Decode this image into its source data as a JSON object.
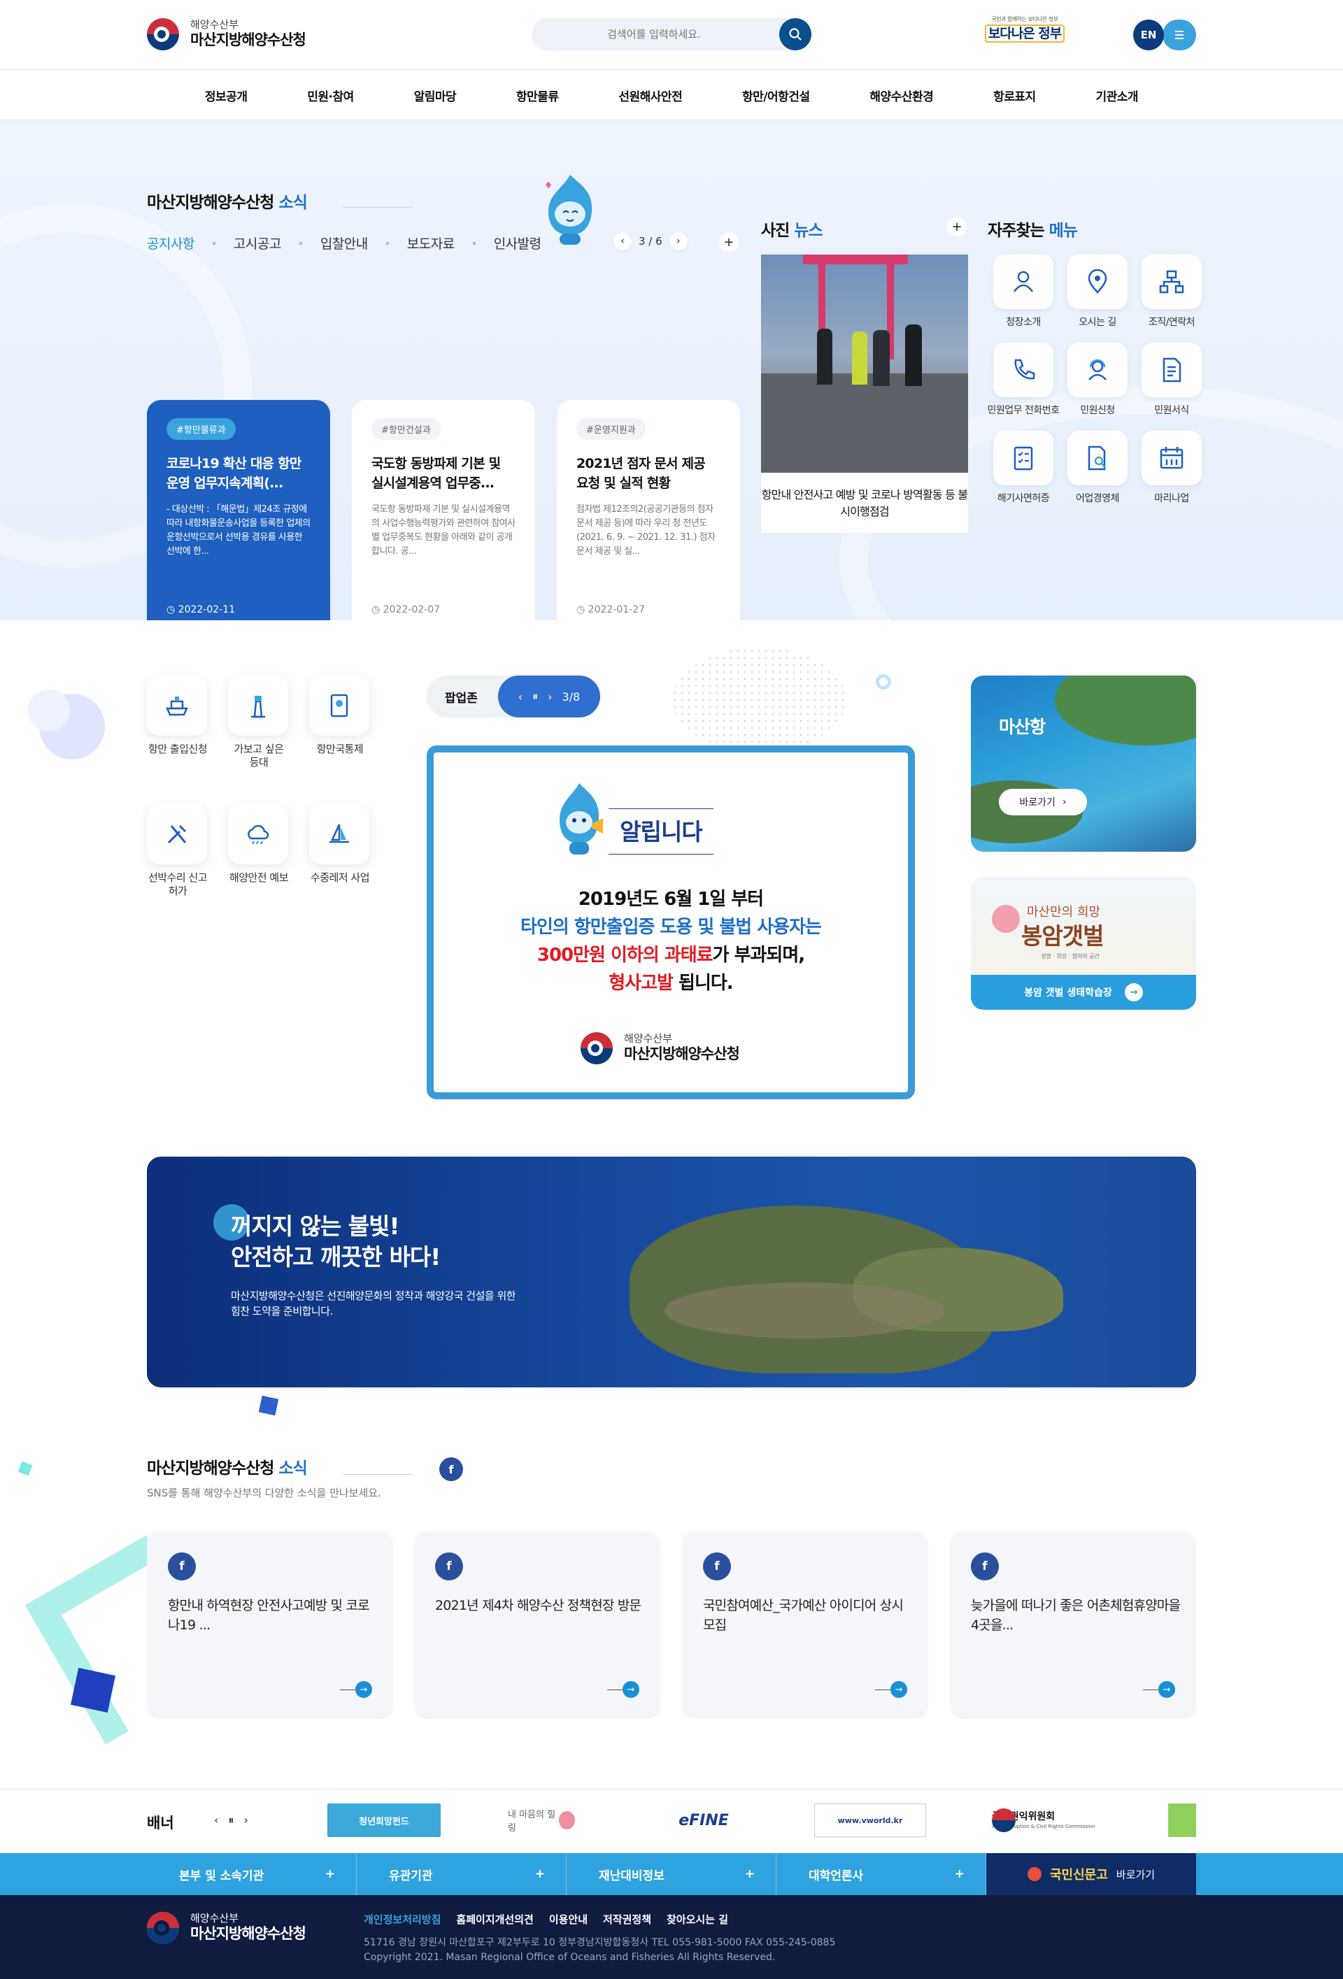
{
  "header": {
    "org_small": "해양수산부",
    "org_name": "마산지방해양수산청",
    "search_placeholder": "검색어를 입력하세요.",
    "gov_small": "국민과 함께하는 보다나은 정부",
    "gov_slogan": "보다나은 정부",
    "lang": "EN"
  },
  "gnb": [
    "정보공개",
    "민원·참여",
    "알림마당",
    "항만물류",
    "선원해사안전",
    "항만/어항건설",
    "해양수산환경",
    "항로표지",
    "기관소개"
  ],
  "news": {
    "title_a": "마산지방해양수산청",
    "title_b": "소식",
    "tabs": [
      "공지사항",
      "고시공고",
      "입찰안내",
      "보도자료",
      "인사발령"
    ],
    "pager": "3 / 6",
    "cards": [
      {
        "tag": "#항만물류과",
        "title": "코로나19 확산 대응 항만 운영 업무지속계획(...",
        "body": "- 대상선박 : 「해운법」제24조 규정에 따라 내항화물운송사업을 등록한 업체의 운항선박으로서 선박용 경유를 사용한 선박에 한...",
        "date": "2022-02-11"
      },
      {
        "tag": "#항만건설과",
        "title": "국도항 동방파제 기본 및 실시설계용역 업무중...",
        "body": "국도항 동방파제 기본 및 실시설계용역의 사업수행능력평가와 관련하여 참여사별 업무중복도 현황을 아래와 같이 공개합니다. 공...",
        "date": "2022-02-07"
      },
      {
        "tag": "#운영지원과",
        "title": "2021년 점자 문서 제공 요청 및 실적 현황",
        "body": "점자법 제12조의2(공공기관등의 점자 문서 제공 등)에 따라 우리 청 전년도(2021. 6. 9. ~ 2021. 12. 31.) 점자 문서 제공 및 실...",
        "date": "2022-01-27"
      }
    ]
  },
  "photo_news": {
    "title_a": "사진",
    "title_b": "뉴스",
    "caption": "항만내 안전사고 예방 및 코로나 방역활동 등 불시이행점검"
  },
  "quick": {
    "title_a": "자주찾는",
    "title_b": "메뉴",
    "items": [
      "청장소개",
      "오시는 길",
      "조직/연락처",
      "민원업무 전화번호",
      "민원신청",
      "민원서식",
      "해기사면허증",
      "어업경영체",
      "마리나업"
    ]
  },
  "services": [
    "항만 출입신청",
    "가보고 싶은 등대",
    "항만국통제",
    "선박수리 신고허가",
    "해양안전 예보",
    "수중레저 사업"
  ],
  "popup": {
    "label": "팝업존",
    "pager": "3/8",
    "head": "알립니다",
    "line1": "2019년도 6월 1일 부터",
    "line2": "타인의 항만출입증 도용 및 불법 사용자는",
    "line3_red": "300만원 이하의 과태료",
    "line3_rest": "가 부과되며,",
    "line4_red": "형사고발",
    "line4_rest": " 됩니다.",
    "org_small": "해양수산부",
    "org_name": "마산지방해양수산청"
  },
  "side_banners": {
    "masan_title": "마산항",
    "masan_btn": "바로가기",
    "bongam_small": "마산만의 희망",
    "bongam_title": "봉암갯벌",
    "bongam_tiny": "생명 · 희망 · 참여의 공간",
    "bongam_btn": "봉암 갯벌 생태학습장"
  },
  "vision": {
    "line1": "꺼지지 않는 불빛!",
    "line2": "안전하고 깨끗한 바다!",
    "desc1": "마산지방해양수산청은 선진해양문화의 정착과 해양강국 건설을 위한",
    "desc2": "힘찬 도약을 준비합니다."
  },
  "sns": {
    "title_a": "마산지방해양수산청",
    "title_b": "소식",
    "sub": "SNS를 통해 해양수산부의 다양한 소식을 만나보세요.",
    "fb": "f",
    "items": [
      "항만내 하역현장 안전사고예방 및 코로나19 ...",
      "2021년 제4차 해양수산 정책현장 방문",
      "국민참여예산_국가예산 아이디어 상시모집",
      "늦가을에 떠나기 좋은 어촌체험휴양마을 4곳을..."
    ]
  },
  "banners": {
    "label": "배너",
    "items": [
      "청년희망펀드",
      "내 마음의 힐링",
      "eFINE",
      "www.vworld.kr",
      "국민권익위원회",
      "Anti-Corruption & Civil Rights Commission"
    ]
  },
  "family": [
    "본부 및 소속기관",
    "유관기관",
    "재난대비정보",
    "대학언론사"
  ],
  "family_special": {
    "name": "국민신문고",
    "go": "바로가기"
  },
  "footer": {
    "links": [
      "개인정보처리방침",
      "홈페이지개선의견",
      "이용안내",
      "저작권정책",
      "찾아오시는 길"
    ],
    "address": "51716 경남 창원시 마산합포구 제2부두로 10 정부경남지방합동청사 TEL 055-981-5000 FAX 055-245-0885",
    "copyright": "Copyright 2021. Masan Regional Office of Oceans and Fisheries All Rights Reserved."
  },
  "colors": {
    "primary": "#1e5fbf",
    "accent": "#3aa3de",
    "navy": "#0b3b7a",
    "footer": "#0f1b3f",
    "alert_red": "#e01c24"
  }
}
